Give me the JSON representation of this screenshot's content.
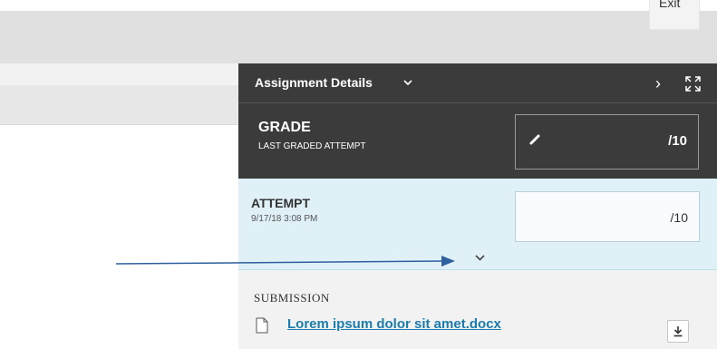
{
  "top_bar": {
    "exit_label": "Exit"
  },
  "panel": {
    "title": "Assignment Details",
    "grade": {
      "label": "GRADE",
      "sub": "LAST GRADED ATTEMPT",
      "value": "/10"
    },
    "attempt": {
      "label": "ATTEMPT",
      "date": "9/17/18 3:08 PM",
      "value": "/10"
    },
    "submission": {
      "title": "SUBMISSION",
      "file_name": "Lorem ipsum dolor sit amet.docx"
    }
  },
  "colors": {
    "panel_dark": "#3b3b3b",
    "attempt_bg": "#dff0f6",
    "link": "#1b7cae",
    "annotation_arrow": "#2e5f9e"
  }
}
